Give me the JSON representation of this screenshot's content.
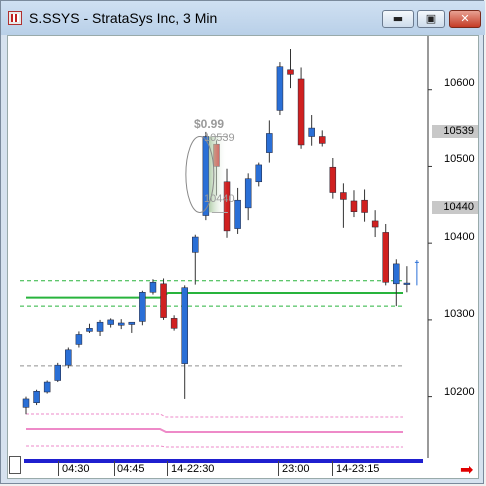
{
  "window": {
    "title": "S.SSYS - StrataSys Inc, 3 Min",
    "minimize_label": "▬",
    "maximize_label": "▣",
    "close_label": "✕"
  },
  "y_axis": {
    "labels": [
      "10600",
      "10539",
      "10500",
      "10440",
      "10400",
      "10300",
      "10200"
    ]
  },
  "price_tags": {
    "current": "10539",
    "low": "10440"
  },
  "x_axis": {
    "labels": [
      "04:30",
      "04:45",
      "14-22:30",
      "23:00",
      "14-23:15"
    ]
  },
  "annotation": {
    "change": "$0.99",
    "high": "10539",
    "low": "10440"
  },
  "colors": {
    "up_candle": "#2a6fd6",
    "down_candle": "#d02020",
    "green_line": "#28b43c",
    "pink_line": "#ee8ac8",
    "grey_line": "#909090"
  },
  "chart_data": {
    "type": "candlestick",
    "candles": [
      {
        "o": 10186,
        "h": 10200,
        "l": 10177,
        "c": 10197,
        "dir": "up"
      },
      {
        "o": 10192,
        "h": 10209,
        "l": 10189,
        "c": 10207,
        "dir": "up"
      },
      {
        "o": 10206,
        "h": 10221,
        "l": 10204,
        "c": 10219,
        "dir": "up"
      },
      {
        "o": 10221,
        "h": 10244,
        "l": 10219,
        "c": 10241,
        "dir": "up"
      },
      {
        "o": 10241,
        "h": 10264,
        "l": 10237,
        "c": 10261,
        "dir": "up"
      },
      {
        "o": 10268,
        "h": 10285,
        "l": 10264,
        "c": 10281,
        "dir": "up"
      },
      {
        "o": 10285,
        "h": 10295,
        "l": 10283,
        "c": 10289,
        "dir": "up"
      },
      {
        "o": 10285,
        "h": 10300,
        "l": 10279,
        "c": 10297,
        "dir": "up"
      },
      {
        "o": 10294,
        "h": 10302,
        "l": 10290,
        "c": 10300,
        "dir": "up"
      },
      {
        "o": 10293,
        "h": 10301,
        "l": 10288,
        "c": 10296,
        "dir": "up"
      },
      {
        "o": 10294,
        "h": 10297,
        "l": 10283,
        "c": 10297,
        "dir": "up"
      },
      {
        "o": 10298,
        "h": 10338,
        "l": 10293,
        "c": 10336,
        "dir": "up"
      },
      {
        "o": 10336,
        "h": 10353,
        "l": 10333,
        "c": 10349,
        "dir": "up"
      },
      {
        "o": 10347,
        "h": 10354,
        "l": 10300,
        "c": 10303,
        "dir": "down"
      },
      {
        "o": 10302,
        "h": 10306,
        "l": 10286,
        "c": 10289,
        "dir": "down"
      },
      {
        "o": 10243,
        "h": 10345,
        "l": 10197,
        "c": 10342,
        "dir": "up"
      },
      {
        "o": 10388,
        "h": 10411,
        "l": 10346,
        "c": 10408,
        "dir": "up"
      },
      {
        "o": 10436,
        "h": 10545,
        "l": 10430,
        "c": 10539,
        "dir": "up"
      },
      {
        "o": 10529,
        "h": 10534,
        "l": 10462,
        "c": 10500,
        "dir": "down"
      },
      {
        "o": 10480,
        "h": 10497,
        "l": 10407,
        "c": 10416,
        "dir": "down"
      },
      {
        "o": 10419,
        "h": 10472,
        "l": 10412,
        "c": 10456,
        "dir": "up"
      },
      {
        "o": 10446,
        "h": 10491,
        "l": 10430,
        "c": 10484,
        "dir": "up"
      },
      {
        "o": 10480,
        "h": 10505,
        "l": 10474,
        "c": 10502,
        "dir": "up"
      },
      {
        "o": 10518,
        "h": 10560,
        "l": 10505,
        "c": 10543,
        "dir": "up"
      },
      {
        "o": 10573,
        "h": 10636,
        "l": 10567,
        "c": 10630,
        "dir": "up"
      },
      {
        "o": 10626,
        "h": 10653,
        "l": 10602,
        "c": 10620,
        "dir": "down"
      },
      {
        "o": 10614,
        "h": 10629,
        "l": 10523,
        "c": 10528,
        "dir": "down"
      },
      {
        "o": 10550,
        "h": 10567,
        "l": 10527,
        "c": 10539,
        "dir": "up"
      },
      {
        "o": 10539,
        "h": 10547,
        "l": 10526,
        "c": 10530,
        "dir": "down"
      },
      {
        "o": 10499,
        "h": 10511,
        "l": 10458,
        "c": 10466,
        "dir": "down"
      },
      {
        "o": 10466,
        "h": 10478,
        "l": 10420,
        "c": 10457,
        "dir": "down"
      },
      {
        "o": 10455,
        "h": 10469,
        "l": 10434,
        "c": 10441,
        "dir": "down"
      },
      {
        "o": 10456,
        "h": 10470,
        "l": 10428,
        "c": 10440,
        "dir": "down"
      },
      {
        "o": 10429,
        "h": 10443,
        "l": 10408,
        "c": 10421,
        "dir": "down"
      },
      {
        "o": 10414,
        "h": 10425,
        "l": 10345,
        "c": 10349,
        "dir": "down"
      },
      {
        "o": 10347,
        "h": 10379,
        "l": 10318,
        "c": 10373,
        "dir": "up"
      },
      {
        "o": 10348,
        "h": 10370,
        "l": 10336,
        "c": 10348,
        "dir": "up"
      }
    ],
    "y_range": [
      10120,
      10670
    ],
    "lines": {
      "green_solid": 10335,
      "green_dashed_upper": 10351,
      "green_dashed_lower": 10318,
      "grey_dashed": 10240
    }
  }
}
